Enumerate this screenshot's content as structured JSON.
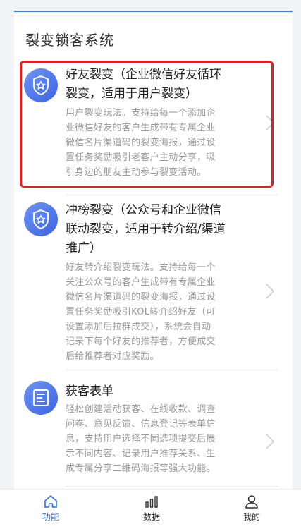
{
  "section_title": "裂变锁客系统",
  "items": [
    {
      "title_lines": [
        "好友裂变（企业微信好友循环",
        "裂变，适用于用户裂变）"
      ],
      "desc_lines": [
        "用户裂变玩法。支持给每一个添加企",
        "业微信好友的客户生成带有专属企业",
        "微信名片渠道码的裂变海报，通过设",
        "置任务奖励吸引老客户主动分享，吸",
        "引身边的朋友主动参与裂变活动。"
      ],
      "icon": "shield-star-icon"
    },
    {
      "title_lines": [
        "冲榜裂变（公众号和企业微信",
        "联动裂变，适用于转介绍/渠道",
        "推广）"
      ],
      "desc_lines": [
        "好友转介绍裂变玩法。支持给每一个",
        "关注公众号的客户生成带有专属企业",
        "微信名片渠道码的裂变海报，通过设",
        "置任务奖励吸引KOL转介绍好友（可",
        "设置添加后拉群成交），系统会自动",
        "记录下每个好友的推荐者，方便成交",
        "后给推荐者对应奖励。"
      ],
      "icon": "shield-star-icon"
    },
    {
      "title_lines": [
        "获客表单"
      ],
      "desc_lines": [
        "轻松创建活动获客、在线收款、调查",
        "问卷、意见反馈、信息登记等表单信",
        "息，支持用户选择不同选项提交后展",
        "示不同内容、记录用户推荐关系、生",
        "成专属分享二维码海报等强大功能。"
      ],
      "icon": "form-list-icon"
    }
  ],
  "tabbar": {
    "tabs": [
      {
        "label": "功能",
        "icon": "home-icon",
        "active": true
      },
      {
        "label": "数据",
        "icon": "bar-chart-icon",
        "active": false
      },
      {
        "label": "我的",
        "icon": "user-icon",
        "active": false
      }
    ]
  },
  "colors": {
    "accent": "#2e6fe0",
    "highlight_border": "#e02020",
    "badge": "#4a70e8"
  }
}
